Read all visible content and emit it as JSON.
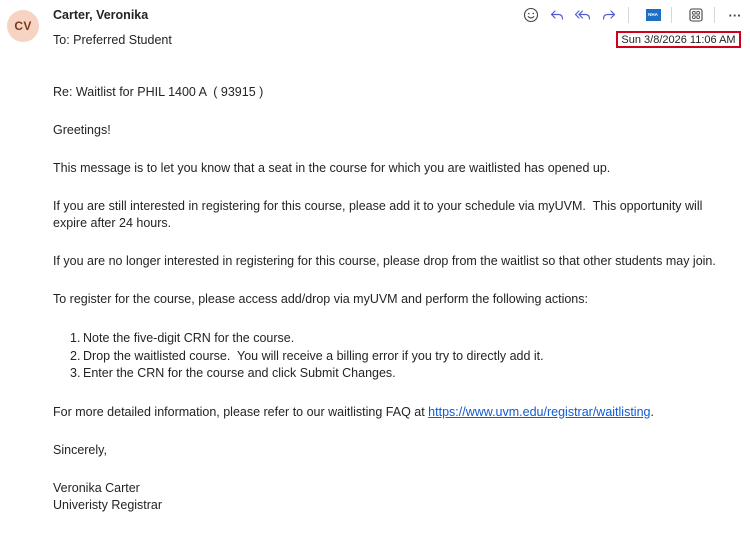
{
  "header": {
    "avatar_initials": "CV",
    "sender_name": "Carter, Veronika",
    "to_prefix": "To:",
    "to_recipient": "Preferred Student",
    "date": "Sun 3/8/2026 11:06 AM"
  },
  "toolbar": {
    "icons": [
      "emoji-icon",
      "reply-icon",
      "reply-all-icon",
      "forward-icon",
      "nha-app-icon",
      "apps-grid-icon",
      "more-options-icon"
    ],
    "nha_label": "NHA",
    "more_label": "···"
  },
  "message": {
    "subject_line": "Re: Waitlist for PHIL 1400 A  ( 93915 )",
    "greeting": "Greetings!",
    "para1": "This message is to let you know that a seat in the course for which you are waitlisted has opened up.",
    "para2": "If you are still interested in registering for this course, please add it to your schedule via myUVM.  This opportunity will expire after 24 hours.",
    "para3": "If you are no longer interested in registering for this course, please drop from the waitlist so that other students may join.",
    "para4": "To register for the course, please access add/drop via myUVM and perform the following actions:",
    "steps": [
      {
        "num": "1.",
        "text": "Note the five-digit CRN for the course."
      },
      {
        "num": "2.",
        "text": "Drop the waitlisted course.  You will receive a billing error if you try to directly add it."
      },
      {
        "num": "3.",
        "text": "Enter the CRN for the course and click Submit Changes."
      }
    ],
    "faq_prefix": "For more detailed information, please refer to our waitlisting FAQ at ",
    "faq_link": "https://www.uvm.edu/registrar/waitlisting",
    "faq_suffix": ".",
    "closing": "Sincerely,",
    "signature_name": "Veronika Carter",
    "signature_title": "Univeristy Registrar"
  },
  "colors": {
    "accent": "#0f5ad8",
    "highlight_border": "#d0021b",
    "avatar_bg": "#f6d3c2"
  }
}
